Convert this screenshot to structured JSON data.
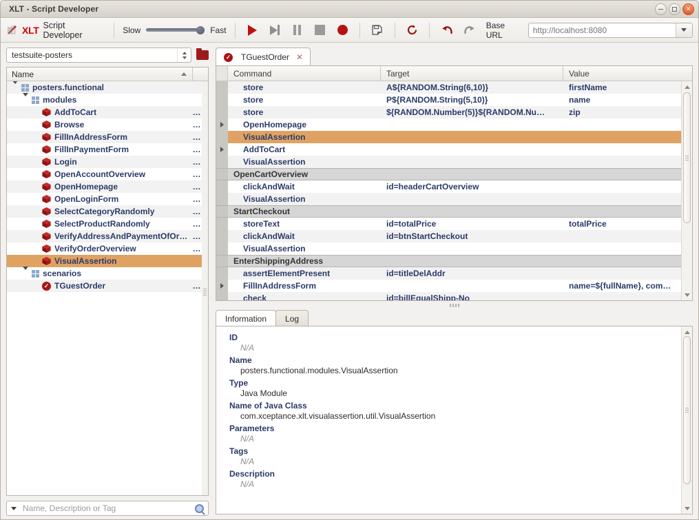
{
  "window": {
    "title": "XLT - Script Developer",
    "minimize_label": "–",
    "maximize_label": "□",
    "close_label": "✕"
  },
  "toolbar": {
    "brand_mark": "XLT",
    "brand_name": "Script Developer",
    "speed_slow_label": "Slow",
    "speed_fast_label": "Fast",
    "speed_value": 100,
    "buttons": [
      {
        "name": "play-button",
        "label": "Play"
      },
      {
        "name": "step-button",
        "label": "Step"
      },
      {
        "name": "pause-button",
        "label": "Pause"
      },
      {
        "name": "stop-button",
        "label": "Stop"
      },
      {
        "name": "record-button",
        "label": "Record"
      },
      {
        "name": "save-button",
        "label": "Save"
      },
      {
        "name": "reload-button",
        "label": "Reload"
      },
      {
        "name": "undo-button",
        "label": "Undo"
      },
      {
        "name": "redo-button",
        "label": "Redo"
      }
    ],
    "base_url_label": "Base URL",
    "base_url_placeholder": "http://localhost:8080",
    "base_url_value": ""
  },
  "sidebar": {
    "testsuite_selected": "testsuite-posters",
    "open_folder_label": "Open folder",
    "column_header": "Name",
    "sort_direction": "asc",
    "search_placeholder": "Name, Description or Tag",
    "search_value": "",
    "tree": [
      {
        "label": "posters.functional",
        "depth": 0,
        "icon": "package-icon",
        "expander": "down",
        "dots": "",
        "selected": false
      },
      {
        "label": "modules",
        "depth": 1,
        "icon": "package-icon",
        "expander": "down",
        "dots": "",
        "selected": false
      },
      {
        "label": "AddToCart",
        "depth": 2,
        "icon": "module-icon",
        "expander": "",
        "dots": "…",
        "selected": false
      },
      {
        "label": "Browse",
        "depth": 2,
        "icon": "module-icon",
        "expander": "",
        "dots": "…",
        "selected": false
      },
      {
        "label": "FillInAddressForm",
        "depth": 2,
        "icon": "module-icon",
        "expander": "",
        "dots": "…",
        "selected": false
      },
      {
        "label": "FillInPaymentForm",
        "depth": 2,
        "icon": "module-icon",
        "expander": "",
        "dots": "…",
        "selected": false
      },
      {
        "label": "Login",
        "depth": 2,
        "icon": "module-icon",
        "expander": "",
        "dots": "…",
        "selected": false
      },
      {
        "label": "OpenAccountOverview",
        "depth": 2,
        "icon": "module-icon",
        "expander": "",
        "dots": "…",
        "selected": false
      },
      {
        "label": "OpenHomepage",
        "depth": 2,
        "icon": "module-icon",
        "expander": "",
        "dots": "…",
        "selected": false
      },
      {
        "label": "OpenLoginForm",
        "depth": 2,
        "icon": "module-icon",
        "expander": "",
        "dots": "…",
        "selected": false
      },
      {
        "label": "SelectCategoryRandomly",
        "depth": 2,
        "icon": "module-icon",
        "expander": "",
        "dots": "…",
        "selected": false
      },
      {
        "label": "SelectProductRandomly",
        "depth": 2,
        "icon": "module-icon",
        "expander": "",
        "dots": "…",
        "selected": false
      },
      {
        "label": "VerifyAddressAndPaymentOfOr…",
        "depth": 2,
        "icon": "module-icon",
        "expander": "",
        "dots": "…",
        "selected": false
      },
      {
        "label": "VerifyOrderOverview",
        "depth": 2,
        "icon": "module-icon",
        "expander": "",
        "dots": "…",
        "selected": false
      },
      {
        "label": "VisualAssertion",
        "depth": 2,
        "icon": "module-icon",
        "expander": "",
        "dots": "",
        "selected": true
      },
      {
        "label": "scenarios",
        "depth": 1,
        "icon": "package-icon",
        "expander": "down",
        "dots": "",
        "selected": false
      },
      {
        "label": "TGuestOrder",
        "depth": 2,
        "icon": "scenario-icon",
        "expander": "",
        "dots": "…",
        "selected": false
      }
    ]
  },
  "editor": {
    "tab": {
      "label": "TGuestOrder",
      "icon": "scenario-icon",
      "close_label": "✕"
    },
    "columns": [
      "Command",
      "Target",
      "Value"
    ],
    "rows": [
      {
        "type": "cmd",
        "expand": false,
        "command": "store",
        "target": "A${RANDOM.String(6,10)}",
        "value": "firstName",
        "selected": false
      },
      {
        "type": "cmd",
        "expand": false,
        "command": "store",
        "target": "P${RANDOM.String(5,10)}",
        "value": "name",
        "selected": false
      },
      {
        "type": "cmd",
        "expand": false,
        "command": "store",
        "target": "${RANDOM.Number(5)}${RANDOM.Nu…",
        "value": "zip",
        "selected": false
      },
      {
        "type": "cmd",
        "expand": true,
        "command": "OpenHomepage",
        "target": "",
        "value": "",
        "selected": false
      },
      {
        "type": "cmd",
        "expand": false,
        "command": "VisualAssertion",
        "target": "",
        "value": "",
        "selected": true
      },
      {
        "type": "cmd",
        "expand": true,
        "command": "AddToCart",
        "target": "",
        "value": "",
        "selected": false
      },
      {
        "type": "cmd",
        "expand": false,
        "command": "VisualAssertion",
        "target": "",
        "value": "",
        "selected": false
      },
      {
        "type": "group",
        "expand": false,
        "command": "OpenCartOverview",
        "target": "",
        "value": "",
        "selected": false
      },
      {
        "type": "cmd",
        "expand": false,
        "command": "clickAndWait",
        "target": "id=headerCartOverview",
        "value": "",
        "selected": false
      },
      {
        "type": "cmd",
        "expand": false,
        "command": "VisualAssertion",
        "target": "",
        "value": "",
        "selected": false
      },
      {
        "type": "group",
        "expand": false,
        "command": "StartCheckout",
        "target": "",
        "value": "",
        "selected": false
      },
      {
        "type": "cmd",
        "expand": false,
        "command": "storeText",
        "target": "id=totalPrice",
        "value": "totalPrice",
        "selected": false
      },
      {
        "type": "cmd",
        "expand": false,
        "command": "clickAndWait",
        "target": "id=btnStartCheckout",
        "value": "",
        "selected": false
      },
      {
        "type": "cmd",
        "expand": false,
        "command": "VisualAssertion",
        "target": "",
        "value": "",
        "selected": false
      },
      {
        "type": "group",
        "expand": false,
        "command": "EnterShippingAddress",
        "target": "",
        "value": "",
        "selected": false
      },
      {
        "type": "cmd",
        "expand": false,
        "command": "assertElementPresent",
        "target": "id=titleDelAddr",
        "value": "",
        "selected": false
      },
      {
        "type": "cmd",
        "expand": true,
        "command": "FillInAddressForm",
        "target": "",
        "value": "name=${fullName}, com…",
        "selected": false
      },
      {
        "type": "cmd",
        "expand": false,
        "command": "check",
        "target": "id=billEqualShipp-No",
        "value": "",
        "selected": false
      }
    ]
  },
  "info": {
    "tabs": [
      {
        "label": "Information",
        "active": true
      },
      {
        "label": "Log",
        "active": false
      }
    ],
    "fields": [
      {
        "key": "ID",
        "value": "N/A",
        "na": true
      },
      {
        "key": "Name",
        "value": "posters.functional.modules.VisualAssertion",
        "na": false
      },
      {
        "key": "Type",
        "value": "Java Module",
        "na": false
      },
      {
        "key": "Name of Java Class",
        "value": "com.xceptance.xlt.visualassertion.util.VisualAssertion",
        "na": false
      },
      {
        "key": "Parameters",
        "value": "N/A",
        "na": true
      },
      {
        "key": "Tags",
        "value": "N/A",
        "na": true
      },
      {
        "key": "Description",
        "value": "N/A",
        "na": true
      }
    ]
  },
  "colors": {
    "selection": "#e0a263",
    "accent_red": "#b41313",
    "link_blue": "#2b3a68",
    "group_row": "#d6d6d6"
  }
}
